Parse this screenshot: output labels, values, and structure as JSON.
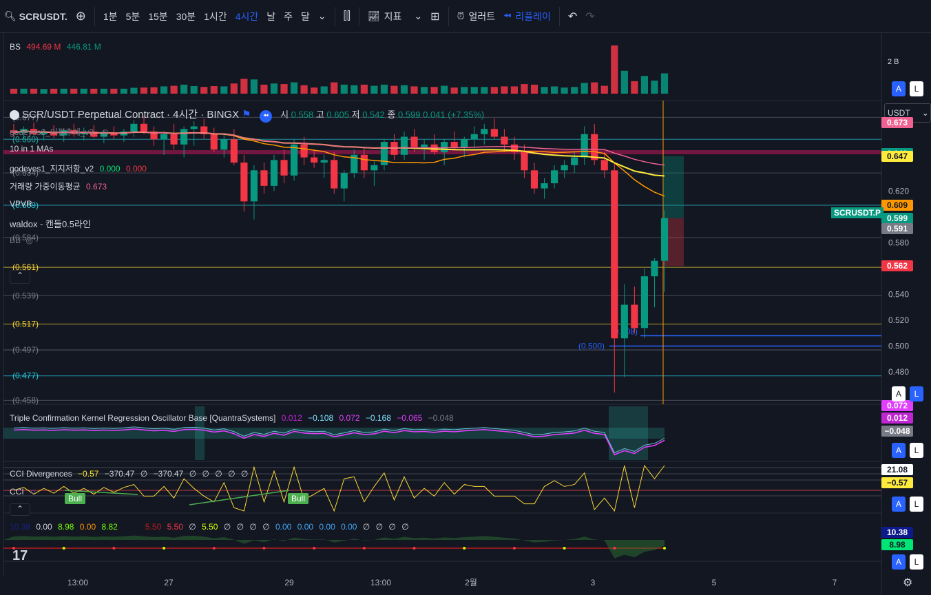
{
  "toolbar": {
    "symbol": "SCRUSDT.",
    "intervals": [
      "1분",
      "5분",
      "15분",
      "30분",
      "1시간",
      "4시간",
      "날",
      "주",
      "달"
    ],
    "active_interval": "4시간",
    "indicators_label": "지표",
    "alert_label": "얼러트",
    "replay_label": "리플레이"
  },
  "legend": {
    "bs_label": "BS",
    "bs_val1": "494.69 M",
    "bs_val2": "446.81 M",
    "title": "SCR/USDT Perpetual Contract · 4시간 · BINGX",
    "ohlc": {
      "o_label": "시",
      "o": "0.558",
      "h_label": "고",
      "h": "0.605",
      "l_label": "저",
      "l": "0.542",
      "c_label": "종",
      "c": "0.599",
      "chg": "0.041 (+7.35%)"
    },
    "ind1": "godeyes2_이평추세_v3",
    "ind2": "10 in 1 MAs",
    "ind3_name": "godeyes1_지지저항_v2",
    "ind3_v1": "0.000",
    "ind3_v2": "0.000",
    "ind4_name": "거래량 가중이동평균",
    "ind4_v": "0.673",
    "ind5": "VPVR",
    "ind6": "waldox - 캔들0.5라인",
    "ind7": "BB",
    "left_levels": [
      "(0.677)",
      "(0.660)",
      "(0.634)",
      "(0.609)",
      "(0.584)",
      "(0.561)",
      "(0.539)",
      "(0.517)",
      "(0.497)",
      "(0.477)",
      "(0.458)"
    ],
    "blue_level_label": "(0.500)",
    "blue_level2_label": "(0.508)"
  },
  "price_axis": {
    "ticks": [
      "0.620",
      "0.580",
      "0.540",
      "0.520",
      "0.500",
      "0.480"
    ],
    "currency": "USDT",
    "symbol_tag": "SCRUSDT.P",
    "tags": [
      {
        "v": "0.673",
        "bg": "#f06292",
        "fg": "#ffffff"
      },
      {
        "v": "0.649",
        "bg": "#089981",
        "fg": "#ffffff"
      },
      {
        "v": "0.647",
        "bg": "#ffeb3b",
        "fg": "#131722"
      },
      {
        "v": "0.609",
        "bg": "#ff9800",
        "fg": "#131722"
      },
      {
        "v": "0.599",
        "bg": "#089981",
        "fg": "#ffffff"
      },
      {
        "v": "0.591",
        "bg": "#787b86",
        "fg": "#ffffff"
      },
      {
        "v": "0.562",
        "bg": "#f23645",
        "fg": "#ffffff"
      }
    ],
    "volume_tick": "2 B"
  },
  "osc1": {
    "name": "Triple Confirmation Kernel Regression Oscillator Base [QuantraSystems]",
    "vals": [
      "0.012",
      "−0.108",
      "0.072",
      "−0.168",
      "−0.065",
      "−0.048"
    ],
    "tags": [
      {
        "v": "0.072",
        "bg": "#e040fb"
      },
      {
        "v": "0.012",
        "bg": "#c026d3"
      },
      {
        "v": "−0.048",
        "bg": "#787b86"
      }
    ]
  },
  "osc2": {
    "name": "CCI Divergences",
    "vals": [
      "−0.57",
      "−370.47",
      "∅",
      "−370.47",
      "∅",
      "∅",
      "∅",
      "∅",
      "∅"
    ],
    "cci_label": "CCI",
    "bull1": "Bull",
    "bull2": "Bull",
    "tags": [
      {
        "v": "21.08",
        "bg": "#ffffff",
        "fg": "#131722"
      },
      {
        "v": "−0.57",
        "bg": "#ffeb3b",
        "fg": "#131722"
      }
    ]
  },
  "osc3": {
    "vals": [
      "10.38",
      "0.00",
      "8.98",
      "0.00",
      "8.82",
      "0.00",
      "5.50",
      "5.50",
      "∅",
      "5.50",
      "∅",
      "∅",
      "∅",
      "∅",
      "0.00",
      "0.00",
      "0.00",
      "0.00",
      "∅",
      "∅",
      "∅",
      "∅"
    ],
    "tags": [
      {
        "v": "10.38",
        "bg": "#0d1a8c",
        "fg": "#ffffff"
      },
      {
        "v": "8.98",
        "bg": "#00e676",
        "fg": "#131722"
      }
    ]
  },
  "time_axis": [
    "13:00",
    "27",
    "29",
    "13:00",
    "2월",
    "3",
    "5",
    "7"
  ],
  "buttons": {
    "a": "A",
    "l": "L"
  },
  "chart_data": {
    "type": "candlestick",
    "title": "SCR/USDT Perpetual Contract · 4시간 · BINGX",
    "ylim": [
      0.455,
      0.69
    ],
    "candles": [
      [
        0.667,
        0.672,
        0.662,
        0.665
      ],
      [
        0.665,
        0.67,
        0.66,
        0.668
      ],
      [
        0.668,
        0.673,
        0.663,
        0.664
      ],
      [
        0.664,
        0.668,
        0.659,
        0.666
      ],
      [
        0.666,
        0.671,
        0.661,
        0.663
      ],
      [
        0.663,
        0.668,
        0.658,
        0.667
      ],
      [
        0.667,
        0.672,
        0.662,
        0.664
      ],
      [
        0.664,
        0.669,
        0.659,
        0.666
      ],
      [
        0.666,
        0.671,
        0.661,
        0.662
      ],
      [
        0.662,
        0.667,
        0.657,
        0.665
      ],
      [
        0.665,
        0.67,
        0.66,
        0.663
      ],
      [
        0.663,
        0.668,
        0.658,
        0.666
      ],
      [
        0.666,
        0.675,
        0.662,
        0.672
      ],
      [
        0.672,
        0.678,
        0.664,
        0.666
      ],
      [
        0.666,
        0.67,
        0.655,
        0.66
      ],
      [
        0.66,
        0.666,
        0.648,
        0.664
      ],
      [
        0.664,
        0.672,
        0.652,
        0.656
      ],
      [
        0.656,
        0.67,
        0.646,
        0.668
      ],
      [
        0.668,
        0.674,
        0.655,
        0.67
      ],
      [
        0.67,
        0.676,
        0.66,
        0.664
      ],
      [
        0.664,
        0.669,
        0.65,
        0.652
      ],
      [
        0.652,
        0.664,
        0.646,
        0.66
      ],
      [
        0.66,
        0.668,
        0.64,
        0.642
      ],
      [
        0.642,
        0.648,
        0.604,
        0.612
      ],
      [
        0.612,
        0.64,
        0.598,
        0.636
      ],
      [
        0.636,
        0.642,
        0.618,
        0.624
      ],
      [
        0.624,
        0.648,
        0.62,
        0.644
      ],
      [
        0.644,
        0.652,
        0.626,
        0.632
      ],
      [
        0.632,
        0.66,
        0.628,
        0.656
      ],
      [
        0.656,
        0.662,
        0.64,
        0.646
      ],
      [
        0.646,
        0.652,
        0.638,
        0.642
      ],
      [
        0.642,
        0.648,
        0.63,
        0.644
      ],
      [
        0.644,
        0.65,
        0.618,
        0.622
      ],
      [
        0.622,
        0.636,
        0.612,
        0.634
      ],
      [
        0.634,
        0.652,
        0.63,
        0.648
      ],
      [
        0.648,
        0.654,
        0.63,
        0.636
      ],
      [
        0.636,
        0.644,
        0.624,
        0.64
      ],
      [
        0.64,
        0.66,
        0.636,
        0.658
      ],
      [
        0.658,
        0.664,
        0.644,
        0.648
      ],
      [
        0.648,
        0.666,
        0.644,
        0.662
      ],
      [
        0.662,
        0.668,
        0.65,
        0.654
      ],
      [
        0.654,
        0.66,
        0.644,
        0.656
      ],
      [
        0.656,
        0.664,
        0.648,
        0.65
      ],
      [
        0.65,
        0.66,
        0.64,
        0.658
      ],
      [
        0.658,
        0.666,
        0.652,
        0.654
      ],
      [
        0.654,
        0.662,
        0.646,
        0.66
      ],
      [
        0.66,
        0.67,
        0.654,
        0.664
      ],
      [
        0.664,
        0.672,
        0.656,
        0.668
      ],
      [
        0.668,
        0.676,
        0.66,
        0.662
      ],
      [
        0.662,
        0.668,
        0.65,
        0.656
      ],
      [
        0.656,
        0.662,
        0.644,
        0.65
      ],
      [
        0.65,
        0.656,
        0.63,
        0.636
      ],
      [
        0.636,
        0.642,
        0.618,
        0.622
      ],
      [
        0.622,
        0.63,
        0.614,
        0.626
      ],
      [
        0.626,
        0.64,
        0.622,
        0.636
      ],
      [
        0.636,
        0.644,
        0.63,
        0.64
      ],
      [
        0.64,
        0.65,
        0.634,
        0.646
      ],
      [
        0.646,
        0.67,
        0.64,
        0.664
      ],
      [
        0.664,
        0.672,
        0.64,
        0.644
      ],
      [
        0.644,
        0.65,
        0.63,
        0.636
      ],
      [
        0.636,
        0.642,
        0.464,
        0.506
      ],
      [
        0.506,
        0.548,
        0.476,
        0.532
      ],
      [
        0.532,
        0.546,
        0.51,
        0.514
      ],
      [
        0.514,
        0.56,
        0.506,
        0.554
      ],
      [
        0.554,
        0.568,
        0.53,
        0.566
      ],
      [
        0.566,
        0.605,
        0.542,
        0.599
      ]
    ]
  }
}
